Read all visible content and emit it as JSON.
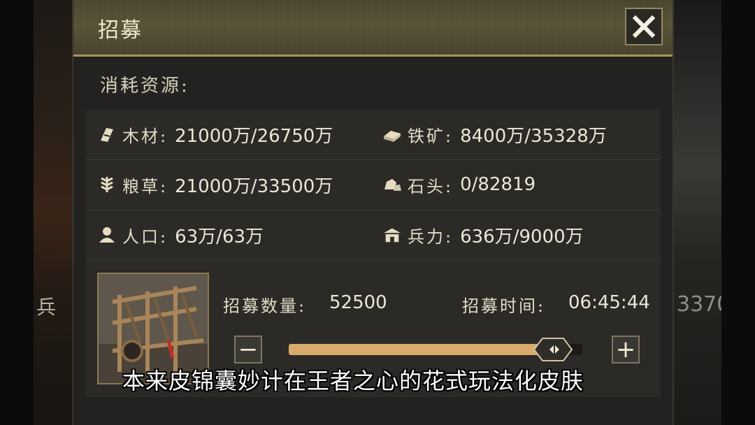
{
  "background": {
    "left_text": "兵",
    "right_text": "3370"
  },
  "dialog": {
    "title": "招募",
    "close_icon": "close-x-icon",
    "consume_label": "消耗资源:"
  },
  "resources": {
    "wood": {
      "icon": "wood-icon",
      "name": "木材:",
      "value": "21000万/26750万"
    },
    "iron": {
      "icon": "iron-icon",
      "name": "铁矿:",
      "value": "8400万/35328万"
    },
    "grain": {
      "icon": "grain-icon",
      "name": "粮草:",
      "value": "21000万/33500万"
    },
    "stone": {
      "icon": "stone-icon",
      "name": "石头:",
      "value": "0/82819"
    },
    "people": {
      "icon": "person-icon",
      "name": "人口:",
      "value": "63万/63万"
    },
    "troops": {
      "icon": "barracks-icon",
      "name": "兵力:",
      "value": "636万/9000万"
    }
  },
  "recruit": {
    "qty_label": "招募数量:",
    "qty_value": "52500",
    "time_label": "招募时间:",
    "time_value": "06:45:44",
    "minus_label": "−",
    "plus_label": "+",
    "slider_fraction": 0.9
  },
  "subtitle": "本来皮锦囊妙计在王者之心的花式玩法化皮肤",
  "colors": {
    "accent_gold": "#d9ab6b",
    "panel": "#2b2a27",
    "header": "#5a5438"
  }
}
